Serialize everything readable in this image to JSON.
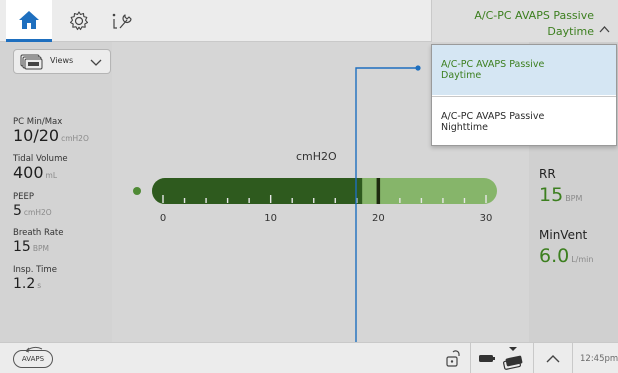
{
  "topbar": {
    "tabs": [
      {
        "name": "home",
        "icon": "home-icon",
        "active": true
      },
      {
        "name": "settings",
        "icon": "gear-icon",
        "active": false
      },
      {
        "name": "tools",
        "icon": "wrench-icon",
        "active": false
      }
    ],
    "mode_line1": "A/C-PC AVAPS Passive",
    "mode_line2": "Daytime"
  },
  "views": {
    "label": "Views"
  },
  "params": [
    {
      "label": "PC Min/Max",
      "value": "10/20",
      "unit": "cmH2O"
    },
    {
      "label": "Tidal Volume",
      "value": "400",
      "unit": "mL"
    },
    {
      "label": "PEEP",
      "value": "5",
      "unit": "cmH2O"
    },
    {
      "label": "Breath Rate",
      "value": "15",
      "unit": "BPM"
    },
    {
      "label": "Insp. Time",
      "value": "1.2",
      "unit": "s"
    }
  ],
  "pressure_bar": {
    "unit_label": "cmH2O",
    "ticks": [
      "0",
      "10",
      "20",
      "30"
    ],
    "range": [
      0,
      30
    ],
    "fill_value": 18.5,
    "marker_value": 20,
    "colors": {
      "dark": "#2e5a1e",
      "light": "#86b56a",
      "marker": "#1e2a10"
    }
  },
  "monitors": [
    {
      "label": "RR",
      "value": "15",
      "unit": "BPM"
    },
    {
      "label": "MinVent",
      "value": "6.0",
      "unit": "L/min"
    }
  ],
  "dropdown": {
    "options": [
      {
        "line1": "A/C-PC AVAPS Passive",
        "line2": "Daytime",
        "selected": true
      },
      {
        "line1": "A/C-PC AVAPS Passive",
        "line2": "Nighttime",
        "selected": false
      }
    ]
  },
  "bottombar": {
    "avaps_label": "AVAPS",
    "time": "12:45pm"
  },
  "colors": {
    "accent_blue": "#1e6fbf",
    "mode_green": "#3c7f1f",
    "callout_line": "#1e6fbf"
  }
}
